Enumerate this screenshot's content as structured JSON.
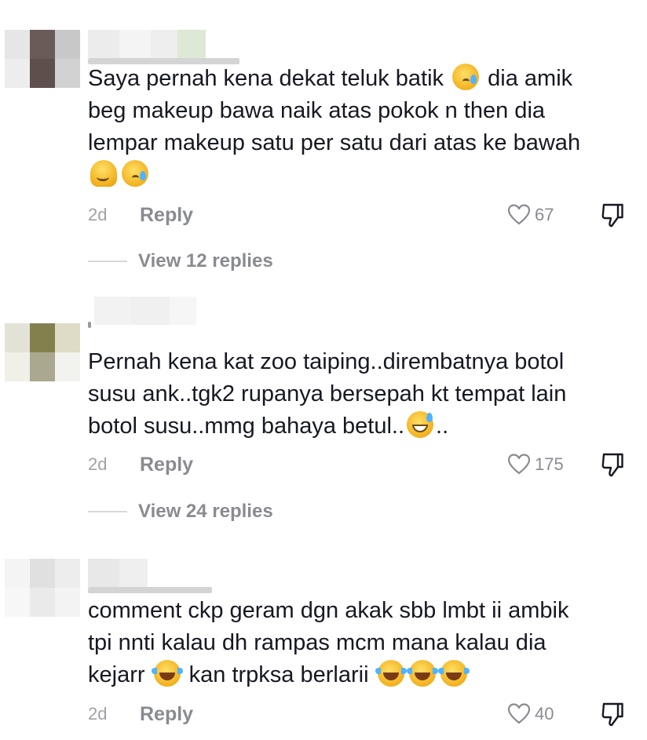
{
  "comments": [
    {
      "text_parts": [
        "Saya pernah kena dekat teluk batik ",
        " dia amik\nbeg makeup bawa naik atas pokok n then dia\nlempar makeup satu per satu dari atas ke bawah\n"
      ],
      "emojis": [
        "tear-face",
        "melting-face",
        "tear-face"
      ],
      "time": "2d",
      "reply_label": "Reply",
      "likes": "67",
      "view_replies": "View 12 replies"
    },
    {
      "text_parts": [
        "Pernah kena kat zoo taiping..dirembatnya botol\nsusu ank..tgk2 rupanya bersepah kt tempat lain\nbotol susu..mmg bahaya betul..",
        ".."
      ],
      "emojis": [
        "sweat-smile-face"
      ],
      "time": "2d",
      "reply_label": "Reply",
      "likes": "175",
      "view_replies": "View 24 replies"
    },
    {
      "text_parts": [
        "comment ckp geram dgn akak sbb lmbt ii ambik\ntpi nnti kalau dh rampas mcm mana kalau dia\nkejarr ",
        " kan trpksa berlarii "
      ],
      "emojis": [
        "tears-of-joy-face",
        "tears-of-joy-face",
        "tears-of-joy-face",
        "tears-of-joy-face"
      ],
      "time": "2d",
      "reply_label": "Reply",
      "likes": "40"
    }
  ],
  "icons": {
    "like": "heart-outline-icon",
    "dislike": "thumbs-down-outline-icon"
  },
  "colors": {
    "text": "#161823",
    "secondary": "#8a8b91",
    "time": "#a1a2a7"
  }
}
